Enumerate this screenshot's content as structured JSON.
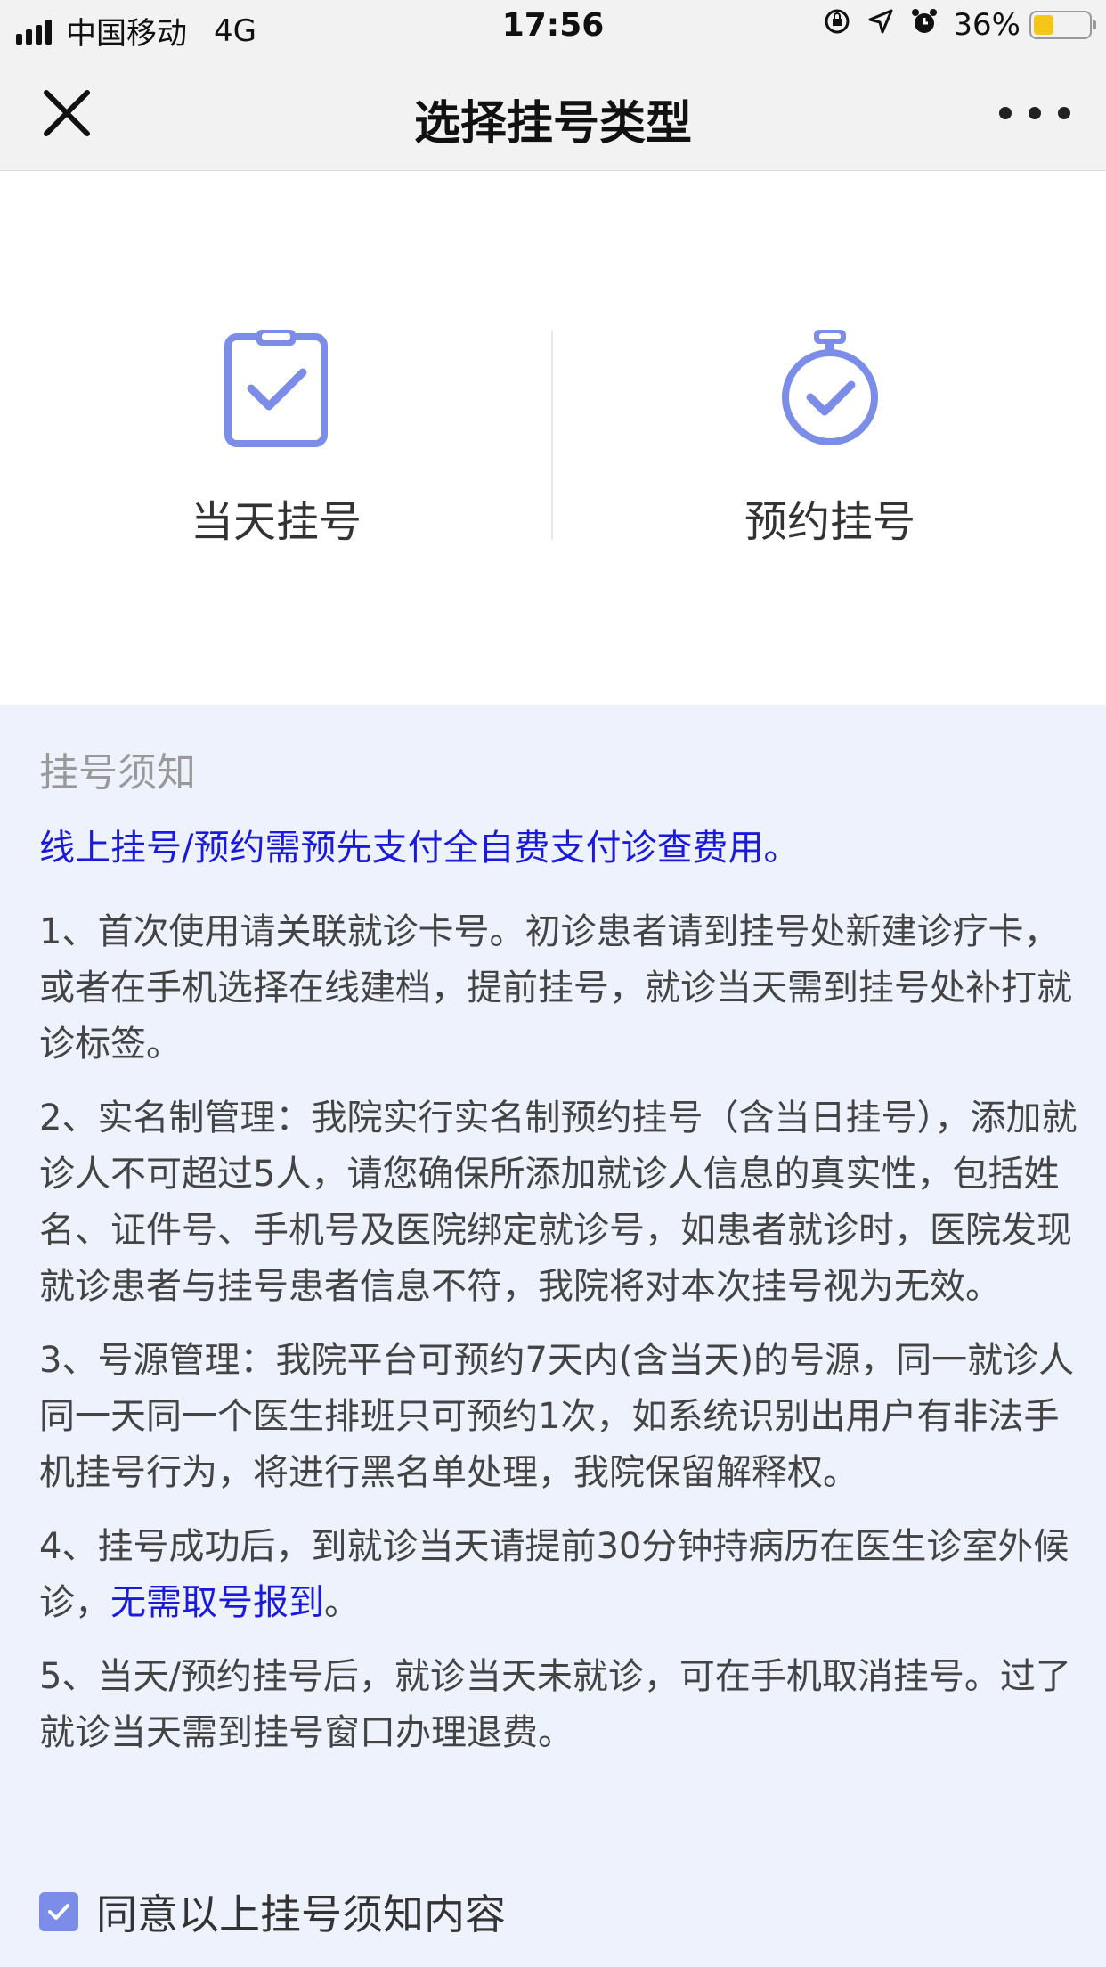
{
  "status_bar": {
    "carrier": "中国移动",
    "network": "4G",
    "time": "17:56",
    "battery_pct": "36%",
    "battery_level": 0.36,
    "icons": [
      "rotation-lock-icon",
      "location-icon",
      "alarm-icon",
      "battery-icon"
    ]
  },
  "nav": {
    "title": "选择挂号类型",
    "close_icon": "close-icon",
    "more_icon": "more-icon"
  },
  "options": [
    {
      "label": "当天挂号",
      "icon": "clipboard-check-icon"
    },
    {
      "label": "预约挂号",
      "icon": "stopwatch-check-icon"
    }
  ],
  "notice": {
    "title": "挂号须知",
    "highlight": "线上挂号/预约需预先支付全自费支付诊查费用。",
    "items": [
      "1、首次使用请关联就诊卡号。初诊患者请到挂号处新建诊疗卡，或者在手机选择在线建档，提前挂号，就诊当天需到挂号处补打就诊标签。",
      "2、实名制管理：我院实行实名制预约挂号（含当日挂号），添加就诊人不可超过5人，请您确保所添加就诊人信息的真实性，包括姓名、证件号、手机号及医院绑定就诊号，如患者就诊时，医院发现就诊患者与挂号患者信息不符，我院将对本次挂号视为无效。",
      "3、号源管理：我院平台可预约7天内(含当天)的号源，同一就诊人同一天同一个医生排班只可预约1次，如系统识别出用户有非法手机挂号行为，将进行黑名单处理，我院保留解释权。"
    ],
    "item4_prefix": "4、挂号成功后，到就诊当天请提前30分钟持病历在医生诊室外候诊，",
    "item4_link": "无需取号报到",
    "item4_suffix": "。",
    "item5": "5、当天/预约挂号后，就诊当天未就诊，可在手机取消挂号。过了就诊当天需到挂号窗口办理退费。"
  },
  "agree": {
    "label": "同意以上挂号须知内容",
    "checked": true
  },
  "colors": {
    "accent": "#7b8de8",
    "link": "#1a1adc",
    "notice_bg": "#edf2fd"
  }
}
